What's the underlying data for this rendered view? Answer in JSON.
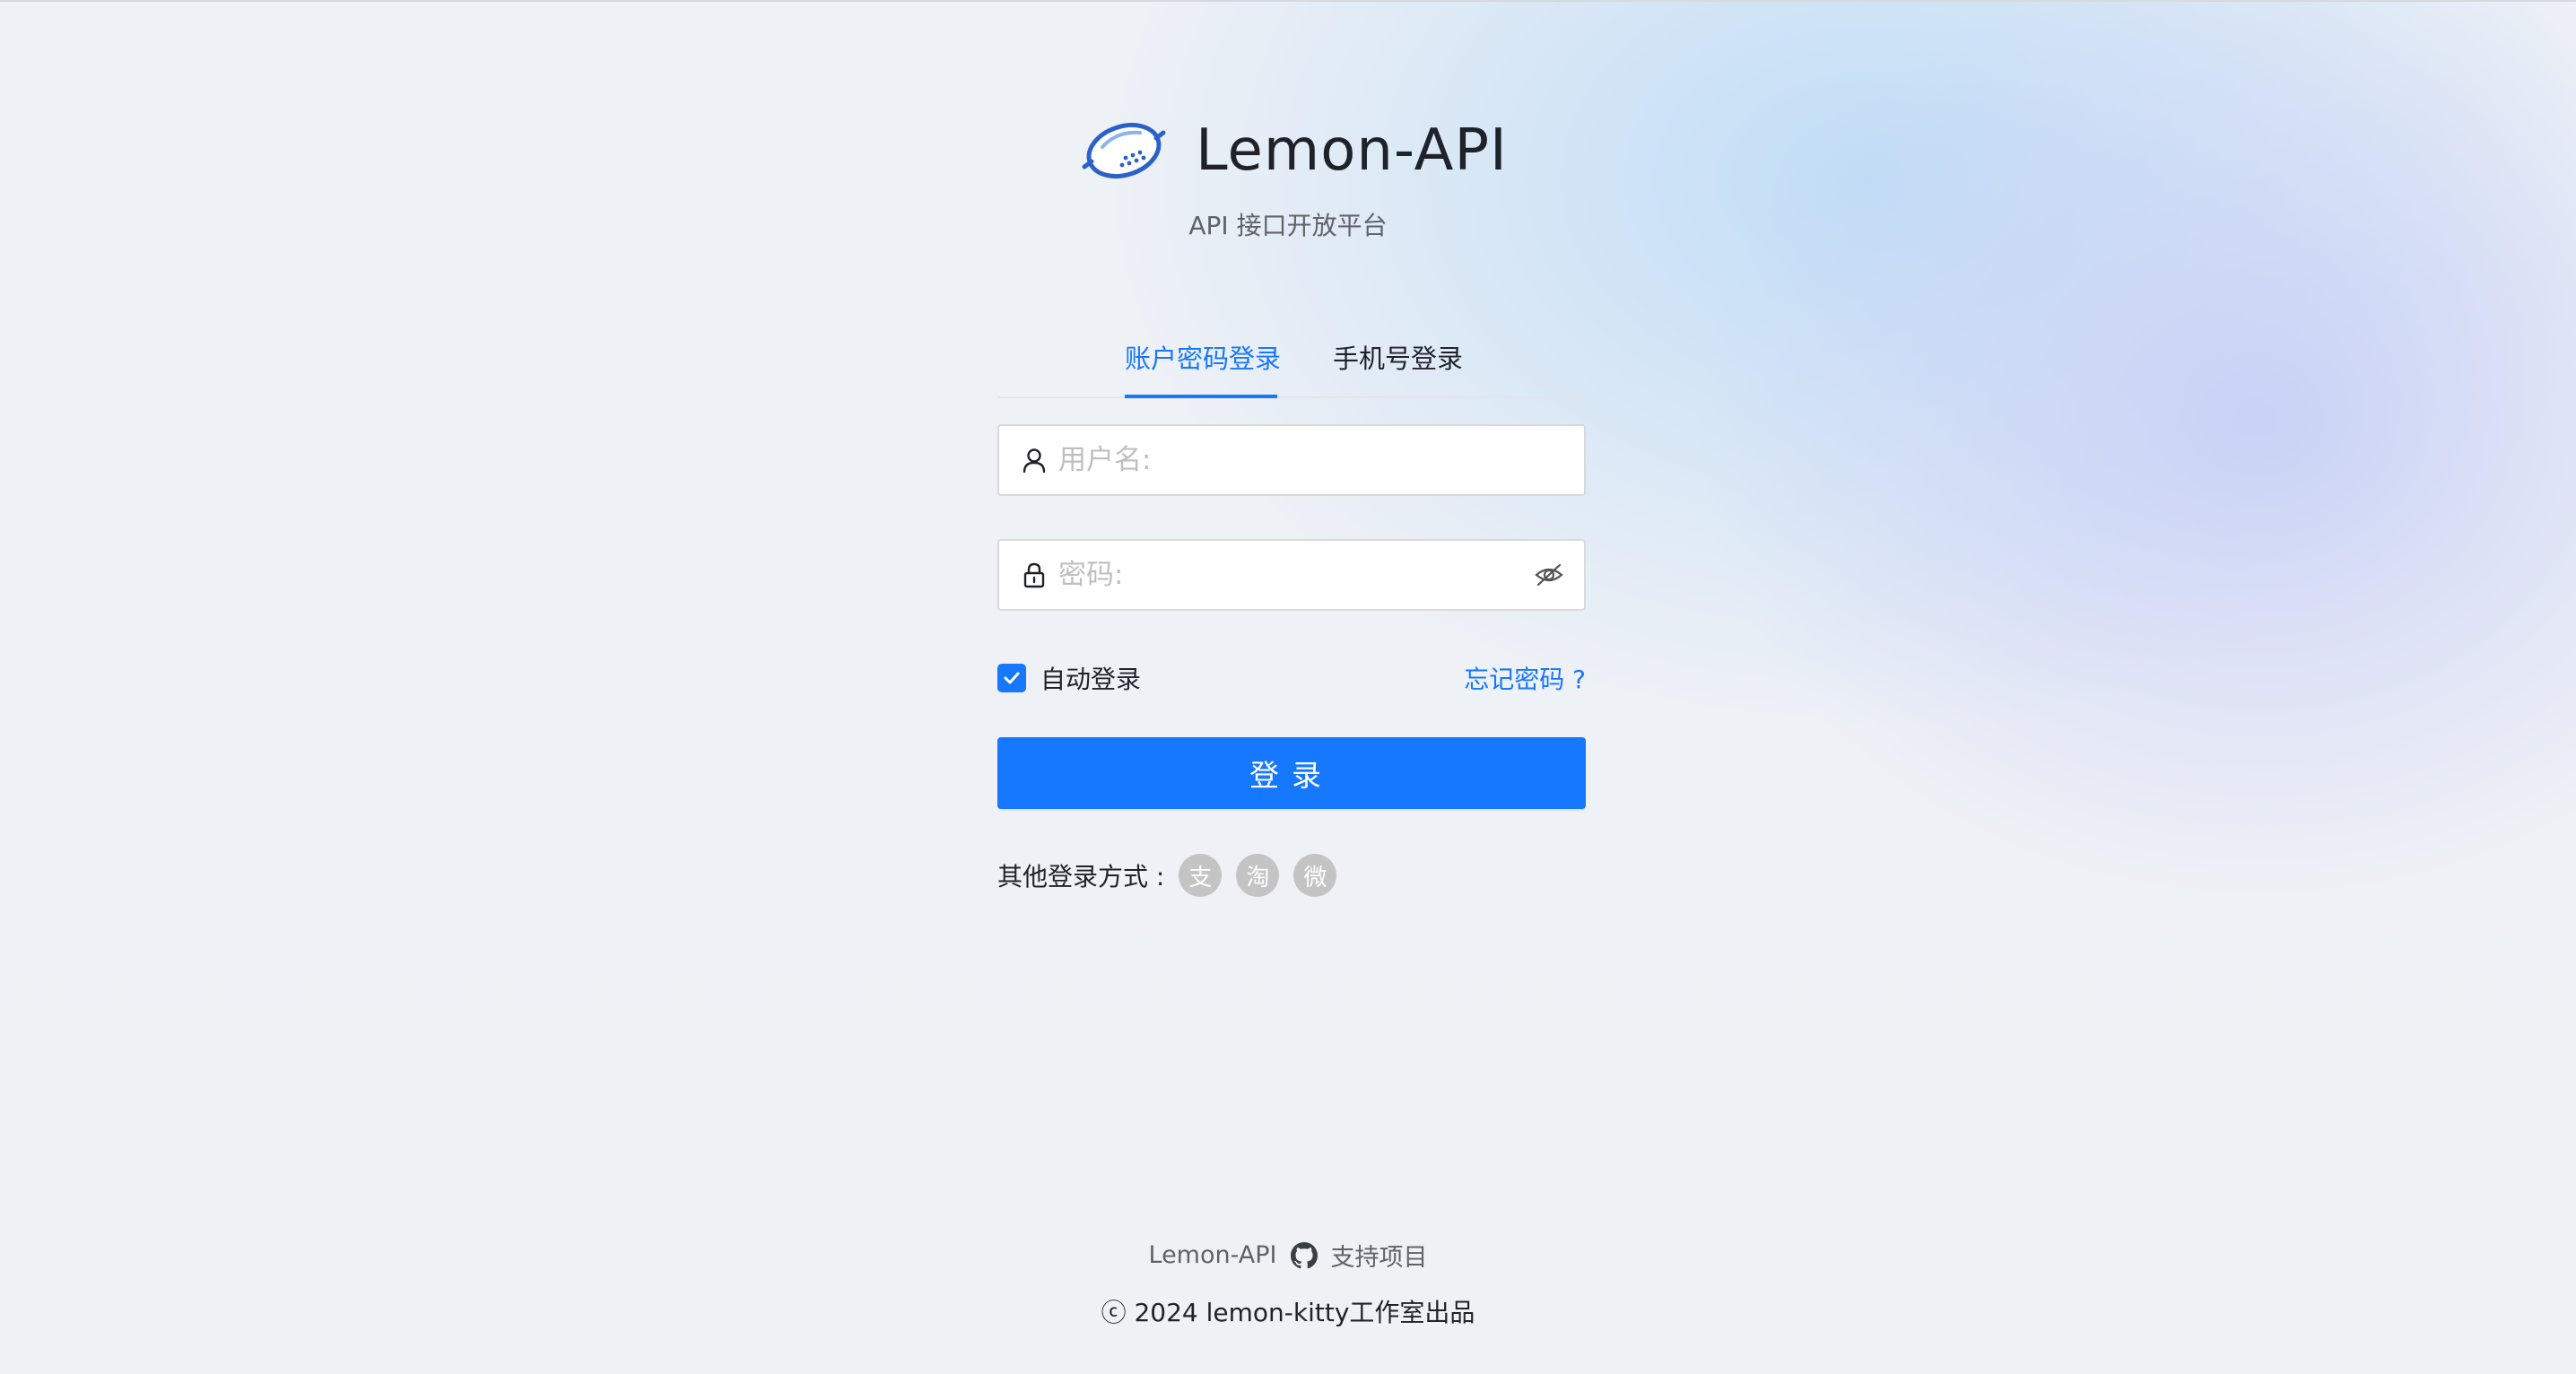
{
  "header": {
    "title": "Lemon-API",
    "subtitle": "API 接口开放平台"
  },
  "tabs": [
    {
      "label": "账户密码登录",
      "active": true
    },
    {
      "label": "手机号登录",
      "active": false
    }
  ],
  "form": {
    "username_placeholder": "用户名:",
    "password_placeholder": "密码:",
    "username_icon": "user-icon",
    "password_icon": "lock-icon",
    "toggle_icon": "eye-invisible-icon",
    "remember_label": "自动登录",
    "remember_checked": true,
    "forgot_label": "忘记密码 ?",
    "submit_label": "登录"
  },
  "other_login": {
    "label": "其他登录方式 :",
    "providers": [
      {
        "name": "alipay-icon",
        "glyph": "支"
      },
      {
        "name": "taobao-icon",
        "glyph": "淘"
      },
      {
        "name": "weibo-icon",
        "glyph": "微"
      }
    ]
  },
  "footer": {
    "project_label": "Lemon-API",
    "support_label": "支持项目",
    "copyright": "ⓒ 2024 lemon-kitty工作室出品"
  },
  "colors": {
    "primary": "#1677ff",
    "text": "#1f2329",
    "muted": "#5f6368",
    "social_gray": "#c4c4c4"
  }
}
